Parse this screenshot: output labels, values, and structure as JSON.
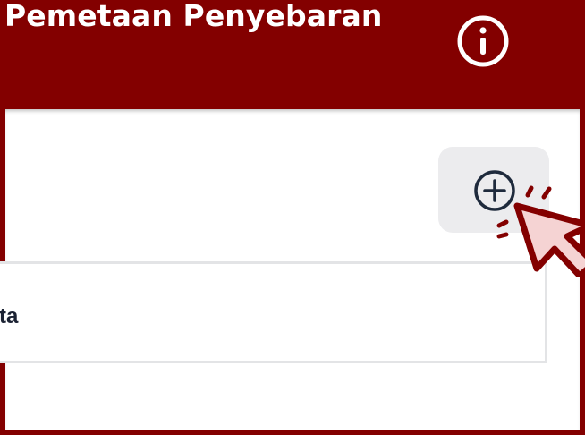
{
  "header": {
    "title": "Pemetaan Penyebaran",
    "info_icon": "info-circle-icon"
  },
  "panel": {
    "add_button_icon": "plus-circle-icon",
    "list_item_text": "ta"
  },
  "pointer": {
    "icon": "click-cursor-icon"
  },
  "colors": {
    "brand": "#830000",
    "surface": "#ffffff",
    "button_bg": "#ececee",
    "border": "#e3e4e6",
    "text_dark": "#1b2233"
  }
}
